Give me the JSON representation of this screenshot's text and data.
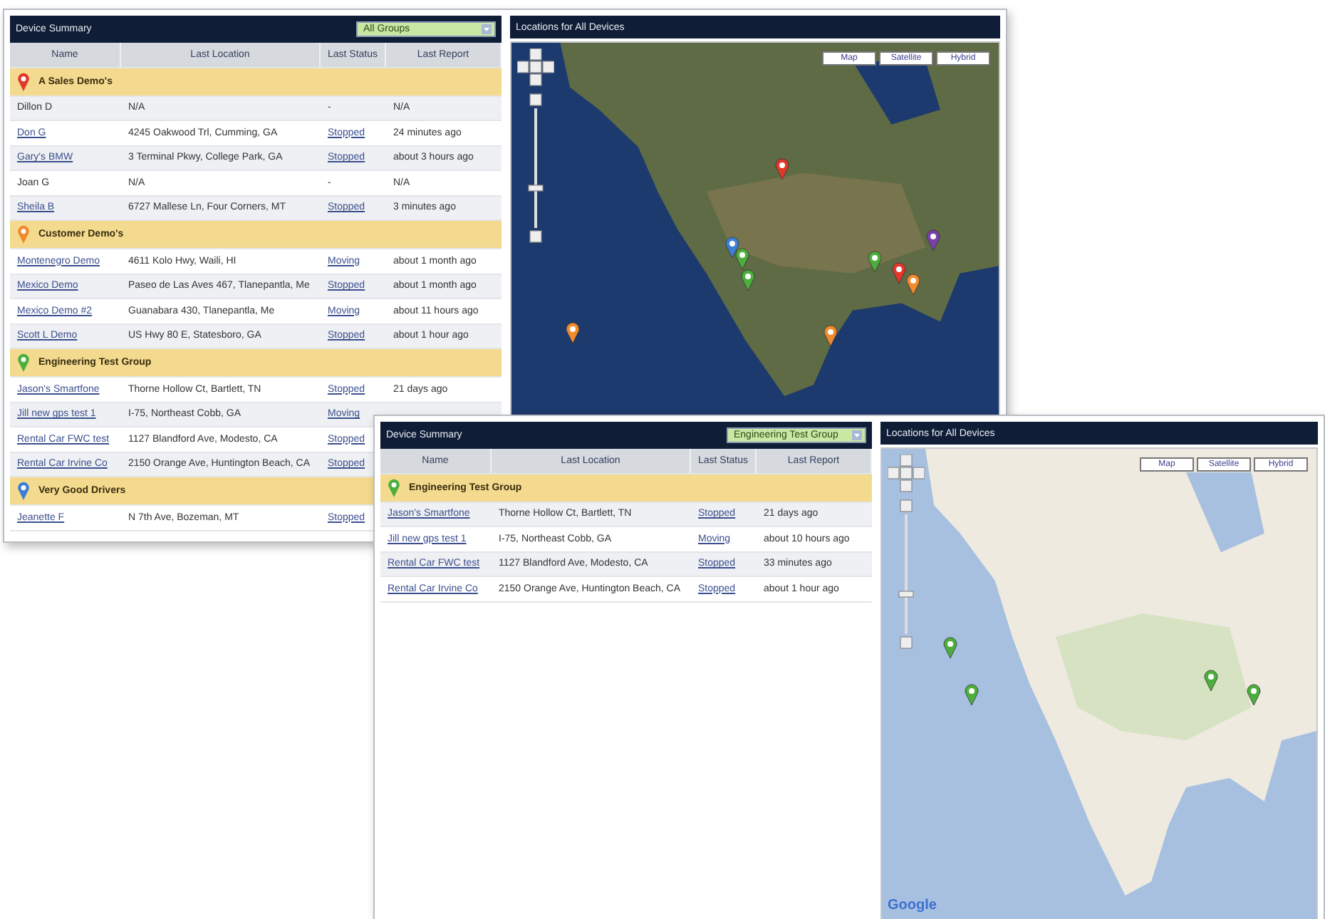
{
  "windows": [
    {
      "device_summary": {
        "title": "Device Summary",
        "group_filter": "All Groups",
        "columns": [
          "Name",
          "Last Location",
          "Last Status",
          "Last Report"
        ],
        "groups": [
          {
            "name": "A Sales Demo's",
            "color": "#e2382a",
            "rows": [
              {
                "name": "Dillon D",
                "linked": false,
                "location": "N/A",
                "status": "-",
                "status_linked": false,
                "report": "N/A"
              },
              {
                "name": "Don G",
                "linked": true,
                "location": "4245 Oakwood Trl, Cumming, GA",
                "status": "Stopped",
                "status_linked": true,
                "report": "24 minutes ago"
              },
              {
                "name": "Gary's BMW",
                "linked": true,
                "location": "3 Terminal Pkwy, College Park, GA",
                "status": "Stopped",
                "status_linked": true,
                "report": "about 3 hours ago"
              },
              {
                "name": "Joan G",
                "linked": false,
                "location": "N/A",
                "status": "-",
                "status_linked": false,
                "report": "N/A"
              },
              {
                "name": "Sheila B",
                "linked": true,
                "location": "6727 Mallese Ln, Four Corners, MT",
                "status": "Stopped",
                "status_linked": true,
                "report": "3 minutes ago"
              }
            ]
          },
          {
            "name": "Customer Demo's",
            "color": "#f08a2c",
            "rows": [
              {
                "name": "Montenegro Demo",
                "linked": true,
                "location": "4611 Kolo Hwy, Waili, HI",
                "status": "Moving",
                "status_linked": true,
                "report": "about 1 month ago"
              },
              {
                "name": "Mexico Demo",
                "linked": true,
                "location": "Paseo de Las Aves 467, Tlanepantla, Me",
                "status": "Stopped",
                "status_linked": true,
                "report": "about 1 month ago"
              },
              {
                "name": "Mexico Demo #2",
                "linked": true,
                "location": "Guanabara 430, Tlanepantla, Me",
                "status": "Moving",
                "status_linked": true,
                "report": "about 11 hours ago"
              },
              {
                "name": "Scott L Demo",
                "linked": true,
                "location": "US Hwy 80 E, Statesboro, GA",
                "status": "Stopped",
                "status_linked": true,
                "report": "about 1 hour ago"
              }
            ]
          },
          {
            "name": "Engineering Test Group",
            "color": "#4caf3c",
            "rows": [
              {
                "name": "Jason's Smartfone",
                "linked": true,
                "location": "Thorne Hollow Ct, Bartlett, TN",
                "status": "Stopped",
                "status_linked": true,
                "report": "21 days ago"
              },
              {
                "name": "Jill new gps test 1",
                "linked": true,
                "location": "I-75, Northeast Cobb, GA",
                "status": "Moving",
                "status_linked": true
              },
              {
                "name": "Rental Car FWC test",
                "linked": true,
                "location": "1127 Blandford Ave, Modesto, CA",
                "status": "Stopped",
                "status_linked": true
              },
              {
                "name": "Rental Car Irvine Co",
                "linked": true,
                "location": "2150 Orange Ave, Huntington Beach, CA",
                "status": "Stopped",
                "status_linked": true
              }
            ]
          },
          {
            "name": "Very Good Drivers",
            "color": "#3d7fd6",
            "rows": [
              {
                "name": "Jeanette F",
                "linked": true,
                "location": "N 7th Ave, Bozeman, MT",
                "status": "Stopped",
                "status_linked": true
              }
            ]
          }
        ]
      },
      "map": {
        "title": "Locations for All Devices",
        "map_types": [
          "Map",
          "Satellite",
          "Hybrid"
        ]
      }
    },
    {
      "device_summary": {
        "title": "Device Summary",
        "group_filter": "Engineering Test Group",
        "columns": [
          "Name",
          "Last Location",
          "Last Status",
          "Last Report"
        ],
        "groups": [
          {
            "name": "Engineering Test Group",
            "color": "#4caf3c",
            "rows": [
              {
                "name": "Jason's Smartfone",
                "linked": true,
                "location": "Thorne Hollow Ct, Bartlett, TN",
                "status": "Stopped",
                "status_linked": true,
                "report": "21 days ago"
              },
              {
                "name": "Jill new gps test 1",
                "linked": true,
                "location": "I-75, Northeast Cobb, GA",
                "status": "Moving",
                "status_linked": true,
                "report": "about 10 hours ago"
              },
              {
                "name": "Rental Car FWC test",
                "linked": true,
                "location": "1127 Blandford Ave, Modesto, CA",
                "status": "Stopped",
                "status_linked": true,
                "report": "33 minutes ago"
              },
              {
                "name": "Rental Car Irvine Co",
                "linked": true,
                "location": "2150 Orange Ave, Huntington Beach, CA",
                "status": "Stopped",
                "status_linked": true,
                "report": "about 1 hour ago"
              }
            ]
          }
        ]
      },
      "map": {
        "title": "Locations for All Devices",
        "map_types": [
          "Map",
          "Satellite",
          "Hybrid"
        ],
        "attribution": "Google"
      }
    }
  ]
}
